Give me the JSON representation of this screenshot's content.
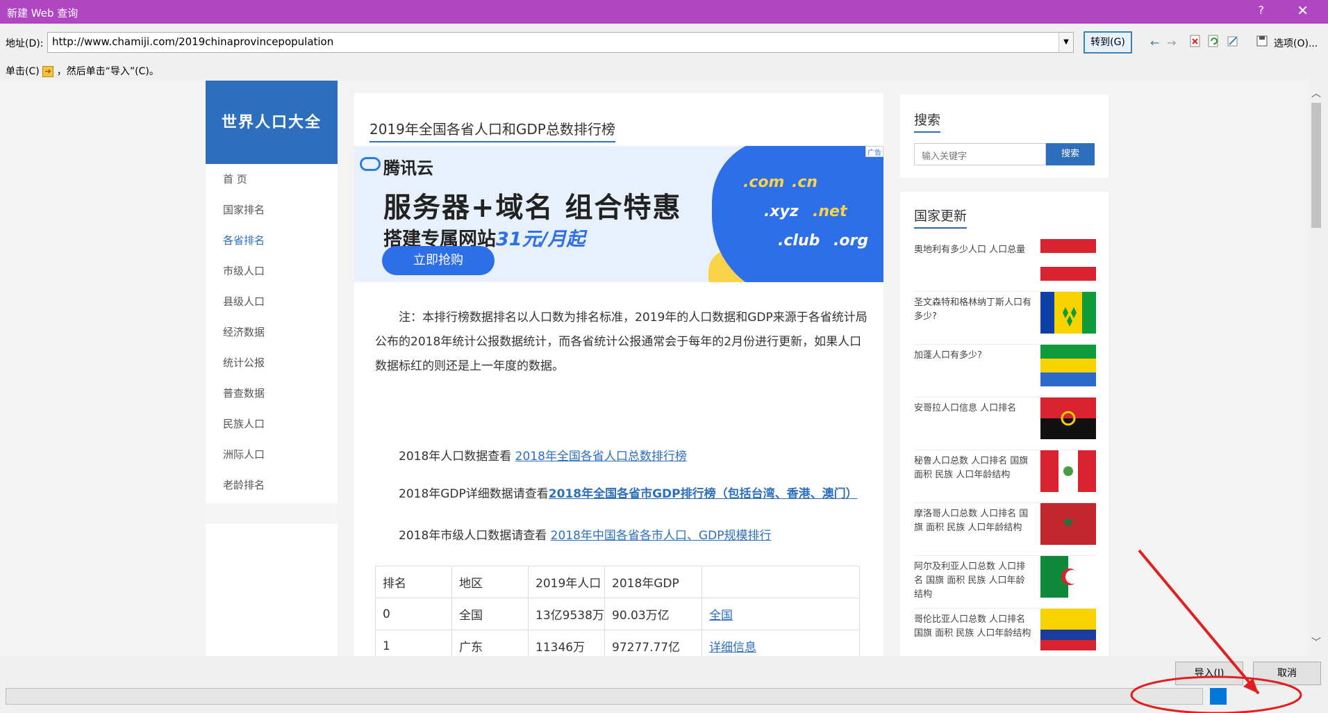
{
  "dialog": {
    "title": "新建 Web 查询",
    "help": "?",
    "close": "✕"
  },
  "address": {
    "label": "地址(D):",
    "url": "http://www.chamiji.com/2019chinaprovincepopulation",
    "goto_label": "转到(G)",
    "options_label": "选项(O)..."
  },
  "hint": {
    "prefix": "单击(C)",
    "suffix": "，然后单击“导入”(C)。"
  },
  "site": {
    "logo": "世界人口大全",
    "nav": [
      "首 页",
      "国家排名",
      "各省排名",
      "市级人口",
      "县级人口",
      "经济数据",
      "统计公报",
      "普查数据",
      "民族人口",
      "洲际人口",
      "老龄排名"
    ],
    "active_nav": "各省排名"
  },
  "main": {
    "title": "2019年全国各省人口和GDP总数排行榜",
    "ad": {
      "brand": "腾讯云",
      "headline": "服务器+域名  组合特惠",
      "sub_prefix": "搭建专属网站",
      "sub_price": "31元/月起",
      "cta": "立即抢购",
      "tags": [
        ".com",
        ".cn",
        ".xyz",
        ".net",
        ".club",
        ".org"
      ],
      "badge": "广告"
    },
    "note": "注：本排行榜数据排名以人口数为排名标准，2019年的人口数据和GDP来源于各省统计局公布的2018年统计公报数据统计，而各省统计公报通常会于每年的2月份进行更新，如果人口数据标红的则还是上一年度的数据。",
    "para1_text": "2018年人口数据查看 ",
    "para1_link": "2018年全国各省人口总数排行榜",
    "para2_text": "2018年GDP详细数据请查看",
    "para2_link": "2018年全国各省市GDP排行榜（包括台湾、香港、澳门）",
    "para3_text": "2018年市级人口数据请查看 ",
    "para3_link": "2018年中国各省各市人口、GDP规模排行",
    "table": {
      "headers": [
        "排名",
        "地区",
        "2019年人口",
        "2018年GDP",
        ""
      ],
      "rows": [
        [
          "0",
          "全国",
          "13亿9538万",
          "90.03万亿",
          "全国"
        ],
        [
          "1",
          "广东",
          "11346万",
          "97277.77亿",
          "详细信息"
        ]
      ]
    }
  },
  "sidebar": {
    "search_title": "搜索",
    "search_placeholder": "输入关键字",
    "search_button": "搜索",
    "updates_title": "国家更新",
    "updates": [
      "奥地利有多少人口 人口总量",
      "圣文森特和格林纳丁斯人口有多少?",
      "加蓬人口有多少?",
      "安哥拉人口信息 人口排名",
      "秘鲁人口总数 人口排名 国旗 面积 民族 人口年龄结构",
      "摩洛哥人口总数 人口排名 国旗 面积 民族 人口年龄结构",
      "阿尔及利亚人口总数 人口排名 国旗 面积 民族 人口年龄结构",
      "哥伦比亚人口总数 人口排名 国旗 面积 民族 人口年龄结构"
    ]
  },
  "buttons": {
    "import": "导入(I)",
    "cancel": "取消"
  },
  "colors": {
    "titlebar": "#b146c2",
    "accent": "#2d6fbd",
    "annotation": "#e02020"
  }
}
